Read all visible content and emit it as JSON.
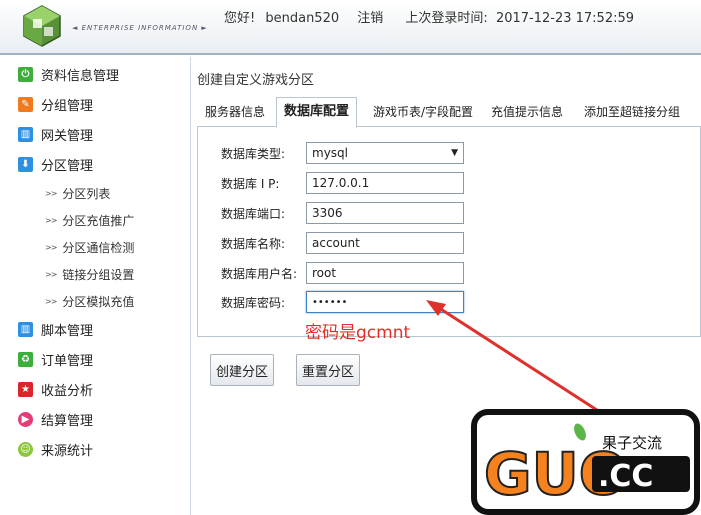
{
  "header": {
    "logo_text": "◄ ENTERPRISE INFORMATION ►",
    "greeting": "您好!",
    "username": "bendan520",
    "logout_label": "注销",
    "last_login_label": "上次登录时间:",
    "last_login_time": "2017-12-23 17:52:59"
  },
  "sidebar": {
    "items": [
      {
        "label": "资料信息管理",
        "icon": "power-icon",
        "color": "#3cae3c"
      },
      {
        "label": "分组管理",
        "icon": "pencil-icon",
        "color": "#f07b1c"
      },
      {
        "label": "网关管理",
        "icon": "grid-icon",
        "color": "#2f8fe0"
      },
      {
        "label": "分区管理",
        "icon": "download-icon",
        "color": "#2f8fe0"
      },
      {
        "label": "脚本管理",
        "icon": "grid-icon",
        "color": "#2f8fe0"
      },
      {
        "label": "订单管理",
        "icon": "recycle-icon",
        "color": "#3cae3c"
      },
      {
        "label": "收益分析",
        "icon": "star-icon",
        "color": "#d9262b"
      },
      {
        "label": "结算管理",
        "icon": "play-icon",
        "color": "#e23d7a"
      },
      {
        "label": "来源统计",
        "icon": "smile-icon",
        "color": "#8cc63f"
      }
    ],
    "sub_items": [
      "分区列表",
      "分区充值推广",
      "分区通信检测",
      "链接分组设置",
      "分区模拟充值"
    ]
  },
  "main": {
    "title": "创建自定义游戏分区",
    "tabs": [
      "服务器信息",
      "数据库配置",
      "游戏币表/字段配置",
      "充值提示信息",
      "添加至超链接分组"
    ],
    "form": {
      "db_type_label": "数据库类型:",
      "db_type_value": "mysql",
      "db_ip_label": "数据库 I P:",
      "db_ip_value": "127.0.0.1",
      "db_port_label": "数据库端口:",
      "db_port_value": "3306",
      "db_name_label": "数据库名称:",
      "db_name_value": "account",
      "db_user_label": "数据库用户名:",
      "db_user_value": "root",
      "db_pass_label": "数据库密码:",
      "db_pass_value": "••••••"
    },
    "buttons": {
      "create": "创建分区",
      "reset": "重置分区"
    }
  },
  "annotation": {
    "text": "密码是gcmnt",
    "color": "#e0302a"
  },
  "watermark": {
    "main": "GUO",
    "domain": ".CC",
    "tagline": "果子交流"
  }
}
